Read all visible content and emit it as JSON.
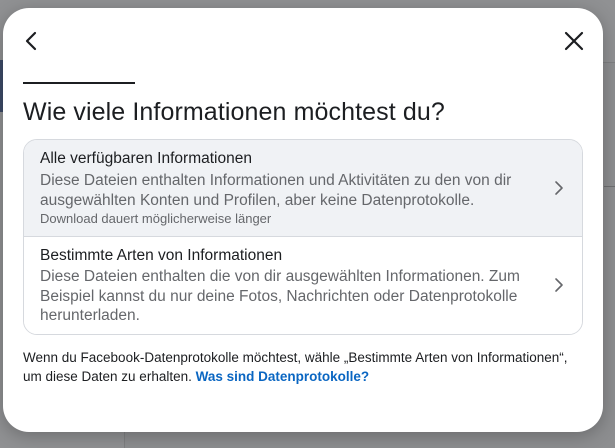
{
  "dialog": {
    "title": "Wie viele Informationen möchtest du?",
    "options": [
      {
        "title": "Alle verfügbaren Informationen",
        "description": "Diese Dateien enthalten Informationen und Aktivitäten zu den von dir ausgewählten Konten und Profilen, aber keine Datenprotokolle.",
        "note": "Download dauert möglicherweise länger"
      },
      {
        "title": "Bestimmte Arten von Informationen",
        "description": "Diese Dateien enthalten die von dir ausgewählten Informationen. Zum Beispiel kannst du nur deine Fotos, Nachrichten oder Datenprotokolle herunterladen."
      }
    ],
    "footer": {
      "text": "Wenn du Facebook-Datenprotokolle möchtest, wähle „Bestimmte Arten von Informationen“, um diese Daten zu erhalten.",
      "link": "Was sind Datenprotokolle?"
    }
  },
  "icons": {
    "back": "chevron-left-icon",
    "close": "close-icon",
    "option_chevron": "chevron-right-icon"
  },
  "colors": {
    "text": "#1c1e21",
    "secondary_text": "#65676b",
    "link": "#0a66c2",
    "selected_option_bg": "#f0f2f5"
  }
}
